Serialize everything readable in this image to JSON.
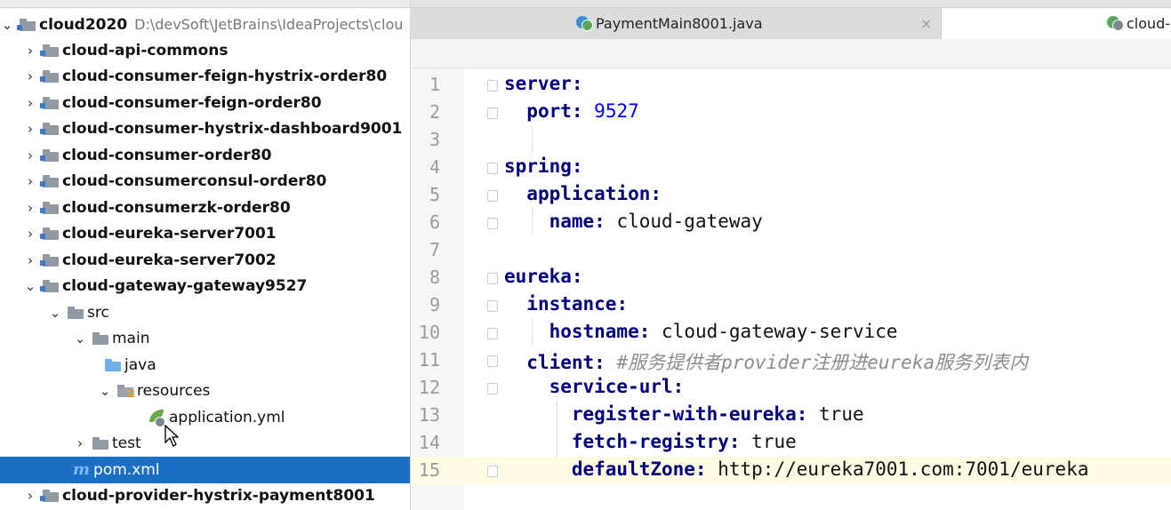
{
  "project": {
    "root": {
      "name": "cloud2020",
      "path": "D:\\devSoft\\JetBrains\\IdeaProjects\\clou"
    },
    "modules": [
      "cloud-api-commons",
      "cloud-consumer-feign-hystrix-order80",
      "cloud-consumer-feign-order80",
      "cloud-consumer-hystrix-dashboard9001",
      "cloud-consumer-order80",
      "cloud-consumerconsul-order80",
      "cloud-consumerzk-order80",
      "cloud-eureka-server7001",
      "cloud-eureka-server7002",
      "cloud-gateway-gateway9527"
    ],
    "gateway_children": {
      "src": "src",
      "main": "main",
      "java": "java",
      "resources": "resources",
      "file": "application.yml",
      "test": "test",
      "pom": "pom.xml",
      "pom_icon": "m"
    },
    "next_module": "cloud-provider-hystrix-payment8001"
  },
  "tabs": [
    {
      "label": "PaymentMain8001.java",
      "close": "×"
    },
    {
      "label": "cloud-"
    }
  ],
  "colors": {
    "selection": "#1a6fc4",
    "key": "#000080",
    "number": "#0000ff",
    "comment": "#8c8c8c"
  },
  "code": {
    "line_numbers": [
      "1",
      "2",
      "3",
      "4",
      "5",
      "6",
      "7",
      "8",
      "9",
      "10",
      "11",
      "12",
      "13",
      "14",
      "15"
    ],
    "l1_key": "server:",
    "l2_key": "port:",
    "l2_val": "9527",
    "l4_key": "spring:",
    "l5_key": "application:",
    "l6_key": "name:",
    "l6_val": "cloud-gateway",
    "l8_key": "eureka:",
    "l9_key": "instance:",
    "l10_key": "hostname:",
    "l10_val": "cloud-gateway-service",
    "l11_key": "client:",
    "l11_comment": "#服务提供者provider注册进eureka服务列表内",
    "l12_key": "service-url:",
    "l13_key": "register-with-eureka:",
    "l13_val": "true",
    "l14_key": "fetch-registry:",
    "l14_val": "true",
    "l15_key": "defaultZone:",
    "l15_val": "http://eureka7001.com:7001/eureka"
  }
}
